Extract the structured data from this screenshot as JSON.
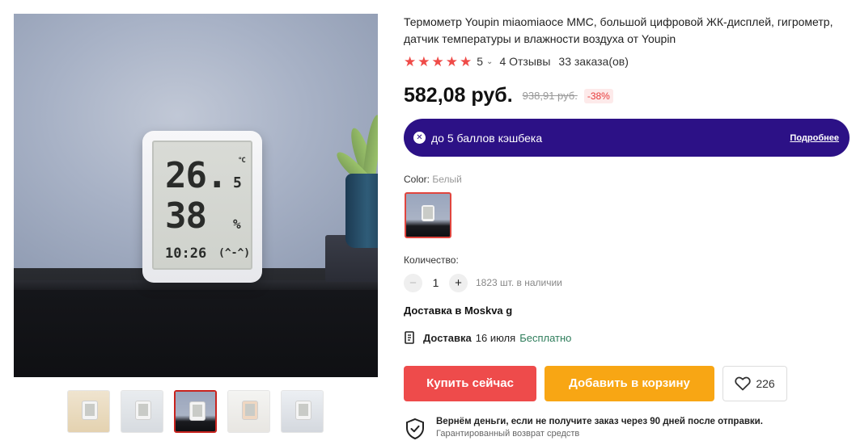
{
  "product": {
    "title": "Термометр Youpin miaomiaoce MMC, большой цифровой ЖК-дисплей, гигрометр, датчик температуры и влажности воздуха от Youpin",
    "gallery": {
      "display": {
        "temperature": "26.",
        "temperature_decimal": "5",
        "temperature_unit": "°C",
        "humidity": "38",
        "humidity_unit": "%",
        "time": "10:26",
        "face": "(^-^)"
      },
      "thumbnail_count": 5,
      "active_thumbnail": 2
    },
    "rating": {
      "stars": 5,
      "score": "5",
      "reviews": "4 Отзывы",
      "orders": "33 заказа(ов)"
    },
    "price": {
      "current": "582,08 руб.",
      "old": "938,91 руб.",
      "discount": "-38%"
    },
    "cashback": {
      "text": "до 5 баллов кэшбека",
      "more_link": "Подробнее",
      "color": "#2c1186"
    },
    "color": {
      "label": "Color:",
      "value": "Белый"
    },
    "quantity": {
      "label": "Количество:",
      "value": "1",
      "stock": "1823 шт. в наличии"
    },
    "delivery": {
      "to": "Доставка в Moskva g",
      "label": "Доставка",
      "date": "16 июля",
      "cost": "Бесплатно"
    },
    "actions": {
      "buy_now": "Купить сейчас",
      "add_to_cart": "Добавить в корзину",
      "wishlist_count": "226",
      "buy_color": "#ee4b4b",
      "cart_color": "#f8a614"
    },
    "guarantee": {
      "title": "Вернём деньги, если не получите заказ через 90 дней после отправки.",
      "subtitle": "Гарантированный возврат средств"
    }
  }
}
